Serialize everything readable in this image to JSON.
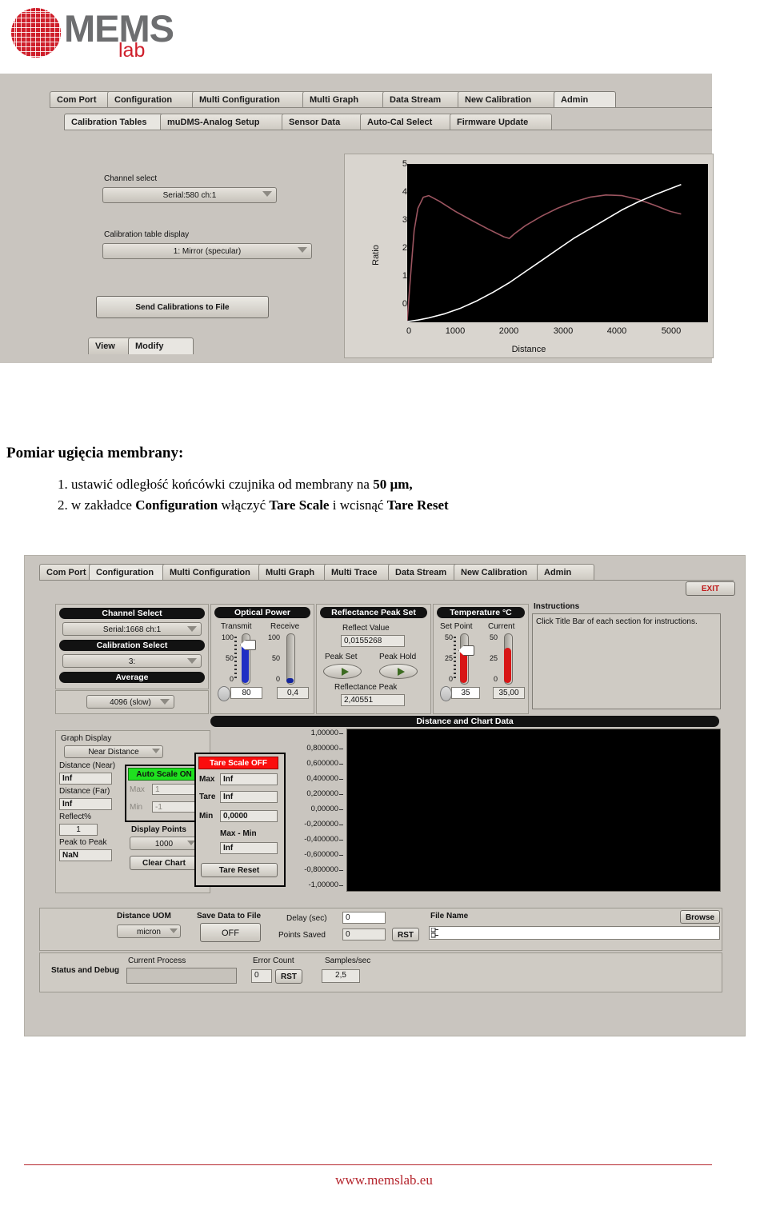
{
  "logo": {
    "mems": "MEMS",
    "lab": "lab"
  },
  "screenshot_top": {
    "tabs_row1": [
      {
        "label": "Com Port",
        "active": false
      },
      {
        "label": "Configuration",
        "active": false
      },
      {
        "label": "Multi Configuration",
        "active": false
      },
      {
        "label": "Multi Graph",
        "active": false
      },
      {
        "label": "Data Stream",
        "active": false
      },
      {
        "label": "New Calibration",
        "active": false
      },
      {
        "label": "Admin",
        "active": true
      }
    ],
    "tabs_row2": [
      {
        "label": "Calibration Tables",
        "active": true
      },
      {
        "label": "muDMS-Analog Setup",
        "active": false
      },
      {
        "label": "Sensor Data",
        "active": false
      },
      {
        "label": "Auto-Cal Select",
        "active": false
      },
      {
        "label": "Firmware Update",
        "active": false
      }
    ],
    "channel_select_label": "Channel select",
    "channel_select_value": "Serial:580 ch:1",
    "calibration_table_label": "Calibration table display",
    "calibration_table_value": "1: Mirror (specular)",
    "send_calibrations_button": "Send Calibrations to File",
    "view_tab": "View",
    "modify_tab": "Modify"
  },
  "chart_data": {
    "type": "line",
    "title": "",
    "xlabel": "Distance",
    "ylabel": "Ratio",
    "xlim": [
      0,
      5600
    ],
    "ylim": [
      0,
      5
    ],
    "xticks": [
      0,
      1000,
      2000,
      3000,
      4000,
      5000
    ],
    "yticks": [
      0,
      1,
      2,
      3,
      4,
      5
    ],
    "grid": false,
    "legend": "none",
    "series": [
      {
        "name": "Ratio (calibration curve)",
        "color": "#9c5560",
        "x": [
          0,
          60,
          130,
          200,
          300,
          400,
          600,
          900,
          1200,
          1500,
          1800,
          1900,
          2000,
          2200,
          2500,
          2800,
          3100,
          3400,
          3700,
          4000,
          4300,
          4600,
          4900,
          5100
        ],
        "y": [
          0.05,
          1.4,
          2.9,
          3.6,
          3.95,
          4.0,
          3.82,
          3.5,
          3.22,
          2.95,
          2.7,
          2.65,
          2.8,
          3.05,
          3.35,
          3.6,
          3.8,
          3.95,
          4.02,
          4.0,
          3.88,
          3.7,
          3.5,
          3.42
        ]
      },
      {
        "name": "Distance response (white)",
        "color": "#ffffff",
        "x": [
          0,
          200,
          400,
          700,
          1000,
          1300,
          1600,
          1900,
          2200,
          2500,
          2800,
          3100,
          3400,
          3700,
          4000,
          4300,
          4600,
          4900,
          5100
        ],
        "y": [
          0.02,
          0.07,
          0.14,
          0.27,
          0.45,
          0.68,
          0.95,
          1.25,
          1.6,
          1.95,
          2.3,
          2.65,
          2.95,
          3.25,
          3.55,
          3.8,
          4.02,
          4.22,
          4.35
        ]
      }
    ]
  },
  "instructions_text": {
    "heading": "Pomiar ugięcia membrany:",
    "item1_pre": "1. ustawić odległość końcówki czujnika od membrany na ",
    "item1_bold": "50 µm,",
    "item2_a": "2. w zakładce ",
    "item2_b1": "Configuration",
    "item2_c": " włączyć ",
    "item2_b2": "Tare Scale",
    "item2_d": " i wcisnąć ",
    "item2_b3": "Tare Reset"
  },
  "screenshot_bottom": {
    "tabs": [
      {
        "label": "Com Port",
        "active": false
      },
      {
        "label": "Configuration",
        "active": true
      },
      {
        "label": "Multi Configuration",
        "active": false
      },
      {
        "label": "Multi Graph",
        "active": false
      },
      {
        "label": "Multi Trace",
        "active": false
      },
      {
        "label": "Data Stream",
        "active": false
      },
      {
        "label": "New Calibration",
        "active": false
      },
      {
        "label": "Admin",
        "active": false
      }
    ],
    "exit_button": "EXIT",
    "channel_select": {
      "title": "Channel Select",
      "value": "Serial:1668 ch:1"
    },
    "calibration_select": {
      "title": "Calibration Select",
      "value": "3:"
    },
    "average": {
      "title": "Average",
      "value": "4096 (slow)"
    },
    "optical_power": {
      "title": "Optical Power",
      "transmit_label": "Transmit",
      "receive_label": "Receive",
      "transmit_value": "80",
      "receive_value": "0,4",
      "scale_ticks": [
        "100",
        "50",
        "0"
      ],
      "transmit_percent": 80,
      "receive_percent": 0.4
    },
    "reflectance_peak_set": {
      "title": "Reflectance Peak Set",
      "reflect_value_label": "Reflect Value",
      "reflect_value": "0,0155268",
      "peak_set_label": "Peak Set",
      "peak_hold_label": "Peak Hold",
      "reflectance_peak_label": "Reflectance Peak",
      "reflectance_peak_value": "2,40551"
    },
    "temperature": {
      "title": "Temperature °C",
      "set_point_label": "Set Point",
      "current_label": "Current",
      "set_point_value": "35",
      "current_value": "35,00",
      "scale_ticks": [
        "50",
        "25",
        "0"
      ],
      "set_point_percent": 70,
      "current_percent": 70
    },
    "instructions": {
      "title": "Instructions",
      "body": "Click Title Bar of each section for instructions."
    },
    "distance_and_chart": {
      "title": "Distance and Chart Data"
    },
    "graph_display": {
      "label": "Graph Display",
      "value": "Near Distance",
      "distance_near_label": "Distance (Near)",
      "distance_near_value": "Inf",
      "distance_far_label": "Distance (Far)",
      "distance_far_value": "Inf",
      "reflect_pct_label": "Reflect%",
      "reflect_pct_value": "1",
      "peak_to_peak_label": "Peak to Peak",
      "peak_to_peak_value": "NaN"
    },
    "auto_scale": {
      "button": "Auto Scale ON",
      "max_label": "Max",
      "max_value": "1",
      "min_label": "Min",
      "min_value": "-1"
    },
    "display_points": {
      "label": "Display Points",
      "value": "1000"
    },
    "clear_chart_button": "Clear Chart",
    "tare": {
      "button": "Tare Scale OFF",
      "max_label": "Max",
      "max_value": "Inf",
      "tare_label": "Tare",
      "tare_value": "Inf",
      "min_label": "Min",
      "min_value": "0,0000",
      "max_min_label": "Max - Min",
      "max_min_value": "Inf",
      "reset_button": "Tare Reset"
    },
    "chart_axis_labels": [
      "1,00000",
      "0,800000",
      "0,600000",
      "0,400000",
      "0,200000",
      "0,00000",
      "-0,200000",
      "-0,400000",
      "-0,600000",
      "-0,800000",
      "-1,00000"
    ],
    "distance_uom": {
      "label": "Distance UOM",
      "value": "micron"
    },
    "save_data": {
      "label": "Save Data to File",
      "value": "OFF"
    },
    "delay": {
      "label": "Delay (sec)",
      "value": "0"
    },
    "points_saved": {
      "label": "Points Saved",
      "value": "0",
      "reset": "RST"
    },
    "file_name": {
      "label": "File Name",
      "value": "",
      "browse": "Browse"
    },
    "status_debug": {
      "label": "Status and Debug",
      "current_process_label": "Current Process",
      "current_process_value": "",
      "error_count_label": "Error Count",
      "error_count_value": "0",
      "error_reset": "RST",
      "samples_label": "Samples/sec",
      "samples_value": "2,5"
    }
  },
  "footer": {
    "url": "www.memslab.eu",
    "accent": "#b5262e"
  }
}
